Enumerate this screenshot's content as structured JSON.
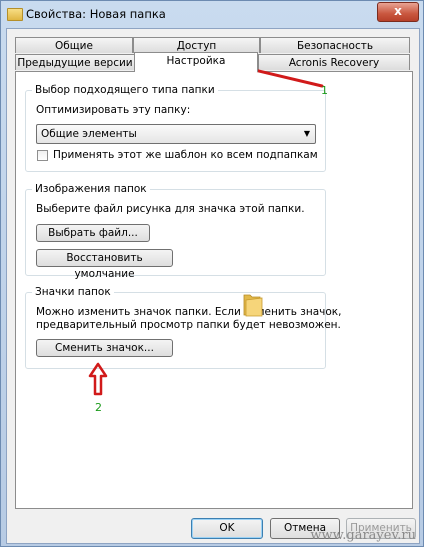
{
  "window": {
    "title": "Свойства: Новая папка",
    "close_label": "x"
  },
  "tabs_top": [
    {
      "label": "Общие"
    },
    {
      "label": "Доступ"
    },
    {
      "label": "Безопасность"
    }
  ],
  "tabs_bottom": [
    {
      "label": "Предыдущие версии"
    },
    {
      "label": "Настройка"
    },
    {
      "label": "Acronis Recovery"
    }
  ],
  "groups": {
    "type": {
      "title": "Выбор подходящего типа папки",
      "optimize_label": "Оптимизировать эту папку:",
      "combo_value": "Общие элементы",
      "checkbox_label": "Применять этот же шаблон ко всем подпапкам",
      "checkbox_checked": false
    },
    "images": {
      "title": "Изображения папок",
      "description": "Выберите файл рисунка для значка этой папки.",
      "choose_file": "Выбрать файл...",
      "restore_default": "Восстановить умолчание"
    },
    "icons": {
      "title": "Значки папок",
      "description_line1": "Можно изменить значок папки. Если изменить значок,",
      "description_line2": "предварительный просмотр папки будет невозможен.",
      "change_icon": "Сменить значок..."
    }
  },
  "footer": {
    "ok": "OK",
    "cancel": "Отмена",
    "apply": "Применить"
  },
  "annotations": {
    "one": "1",
    "two": "2",
    "arrow_color": "#d11a1a",
    "number_color": "#1a9a1a"
  },
  "watermark": "www.garayev.ru"
}
